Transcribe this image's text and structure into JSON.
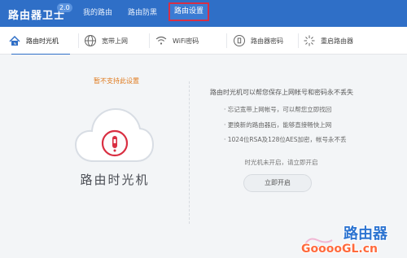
{
  "header": {
    "title": "路由器卫士",
    "version": "2.0",
    "nav": [
      "我的路由",
      "路由防黑",
      "路由设置"
    ]
  },
  "tabs": [
    {
      "label": "路由时光机",
      "icon": "clock-home-icon",
      "active": true
    },
    {
      "label": "宽带上网",
      "icon": "globe-icon",
      "active": false
    },
    {
      "label": "WiFi密码",
      "icon": "wifi-icon",
      "active": false
    },
    {
      "label": "路由器密码",
      "icon": "lock-circle-icon",
      "active": false
    },
    {
      "label": "重启路由器",
      "icon": "spark-icon",
      "active": false
    }
  ],
  "main": {
    "notice": "暂不支持此设置",
    "feature_name": "路由时光机",
    "description_title": "路由时光机可以帮您保存上网帐号和密码永不丢失",
    "description_items": [
      "· 忘记宽带上网帐号，可以帮您立即找回",
      "· 更换新的路由器后，能够直接畅快上网",
      "· 1024位RSA及128位AES加密，帐号永不丢"
    ],
    "status": "时光机未开启，请立即开启",
    "button": "立即开启"
  },
  "watermark": {
    "cn_text": "路由器",
    "en_text": "GooooGL.cn"
  },
  "colors": {
    "header": "#2f6fc7",
    "highlight_border": "#d62f46",
    "notice": "#e07b1f"
  }
}
